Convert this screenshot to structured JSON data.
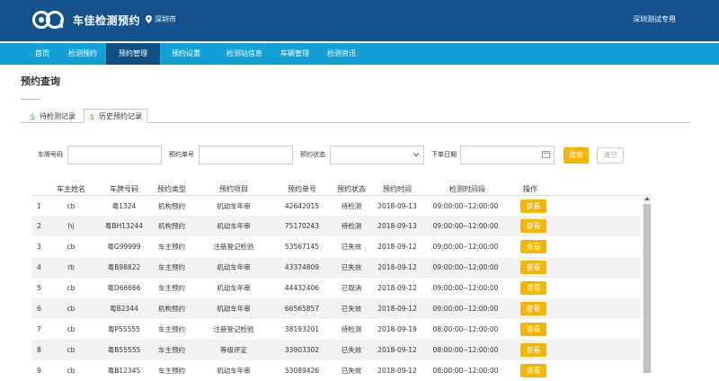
{
  "header": {
    "app_title": "车佳检测预约",
    "city": "深圳市",
    "user": "深圳测试专用",
    "brand_color": "#13528d"
  },
  "nav": {
    "items": [
      "首页",
      "检测预约",
      "预约管理",
      "预约设置",
      "检测站信息",
      "车辆管理",
      "检测资讯"
    ],
    "active": "预约管理",
    "bar_color": "#13a0d6"
  },
  "page": {
    "title": "预约查询"
  },
  "tabs": {
    "items": [
      "待检测记录",
      "历史预约记录"
    ],
    "active": "历史预约记录"
  },
  "search": {
    "plate_label": "车牌号码",
    "plate_value": "",
    "order_label": "预约单号",
    "order_value": "",
    "status_label": "预约状态",
    "status_value": "",
    "date_label": "下单日期",
    "date_value": "",
    "search_button": "搜索",
    "clear_button": "清空",
    "accent_color": "#f7b500"
  },
  "table": {
    "headers": [
      "车主姓名",
      "车牌号码",
      "预约类型",
      "预约项目",
      "预约单号",
      "预约状态",
      "预约时间",
      "检测时间段",
      "操作"
    ],
    "action_label": "查看",
    "rows": [
      {
        "no": "1",
        "owner": "cb",
        "plate": "粤1324",
        "type": "机构预约",
        "item": "机动车年审",
        "order": "42642015",
        "status": "待检测",
        "date": "2018-09-13",
        "slot": "09:00:00--12:00:00"
      },
      {
        "no": "2",
        "owner": "hj",
        "plate": "粤BH13244",
        "type": "机构预约",
        "item": "机动车年审",
        "order": "75170243",
        "status": "待检测",
        "date": "2018-09-13",
        "slot": "09:00:00--12:00:00"
      },
      {
        "no": "3",
        "owner": "cb",
        "plate": "粤G99999",
        "type": "车主预约",
        "item": "注册登记检验",
        "order": "53567145",
        "status": "已失效",
        "date": "2018-09-12",
        "slot": "09:00:00--12:00:00"
      },
      {
        "no": "4",
        "owner": "rb",
        "plate": "粤B98822",
        "type": "车主预约",
        "item": "机动车年审",
        "order": "43374809",
        "status": "已失效",
        "date": "2018-09-12",
        "slot": "09:00:00--12:00:00"
      },
      {
        "no": "5",
        "owner": "cb",
        "plate": "粤D66666",
        "type": "车主预约",
        "item": "机动车年审",
        "order": "44432406",
        "status": "已取消",
        "date": "2018-09-12",
        "slot": "09:00:00--12:00:00"
      },
      {
        "no": "6",
        "owner": "cb",
        "plate": "粤B2344",
        "type": "机构预约",
        "item": "机动车年审",
        "order": "66565857",
        "status": "已失效",
        "date": "2018-09-12",
        "slot": "09:00:00--12:00:00"
      },
      {
        "no": "7",
        "owner": "cb",
        "plate": "粤P55555",
        "type": "车主预约",
        "item": "注册登记检验",
        "order": "38193201",
        "status": "待检测",
        "date": "2018-09-19",
        "slot": "08:00:00--12:00:00"
      },
      {
        "no": "8",
        "owner": "cb",
        "plate": "粤B55555",
        "type": "车主预约",
        "item": "等级评定",
        "order": "33903302",
        "status": "已失效",
        "date": "2018-09-12",
        "slot": "08:00:00--12:00:00"
      },
      {
        "no": "9",
        "owner": "cb",
        "plate": "粤B12345",
        "type": "车主预约",
        "item": "机动车年审",
        "order": "53089426",
        "status": "已失效",
        "date": "2018-09-12",
        "slot": "08:00:00--12:00:00"
      }
    ]
  }
}
